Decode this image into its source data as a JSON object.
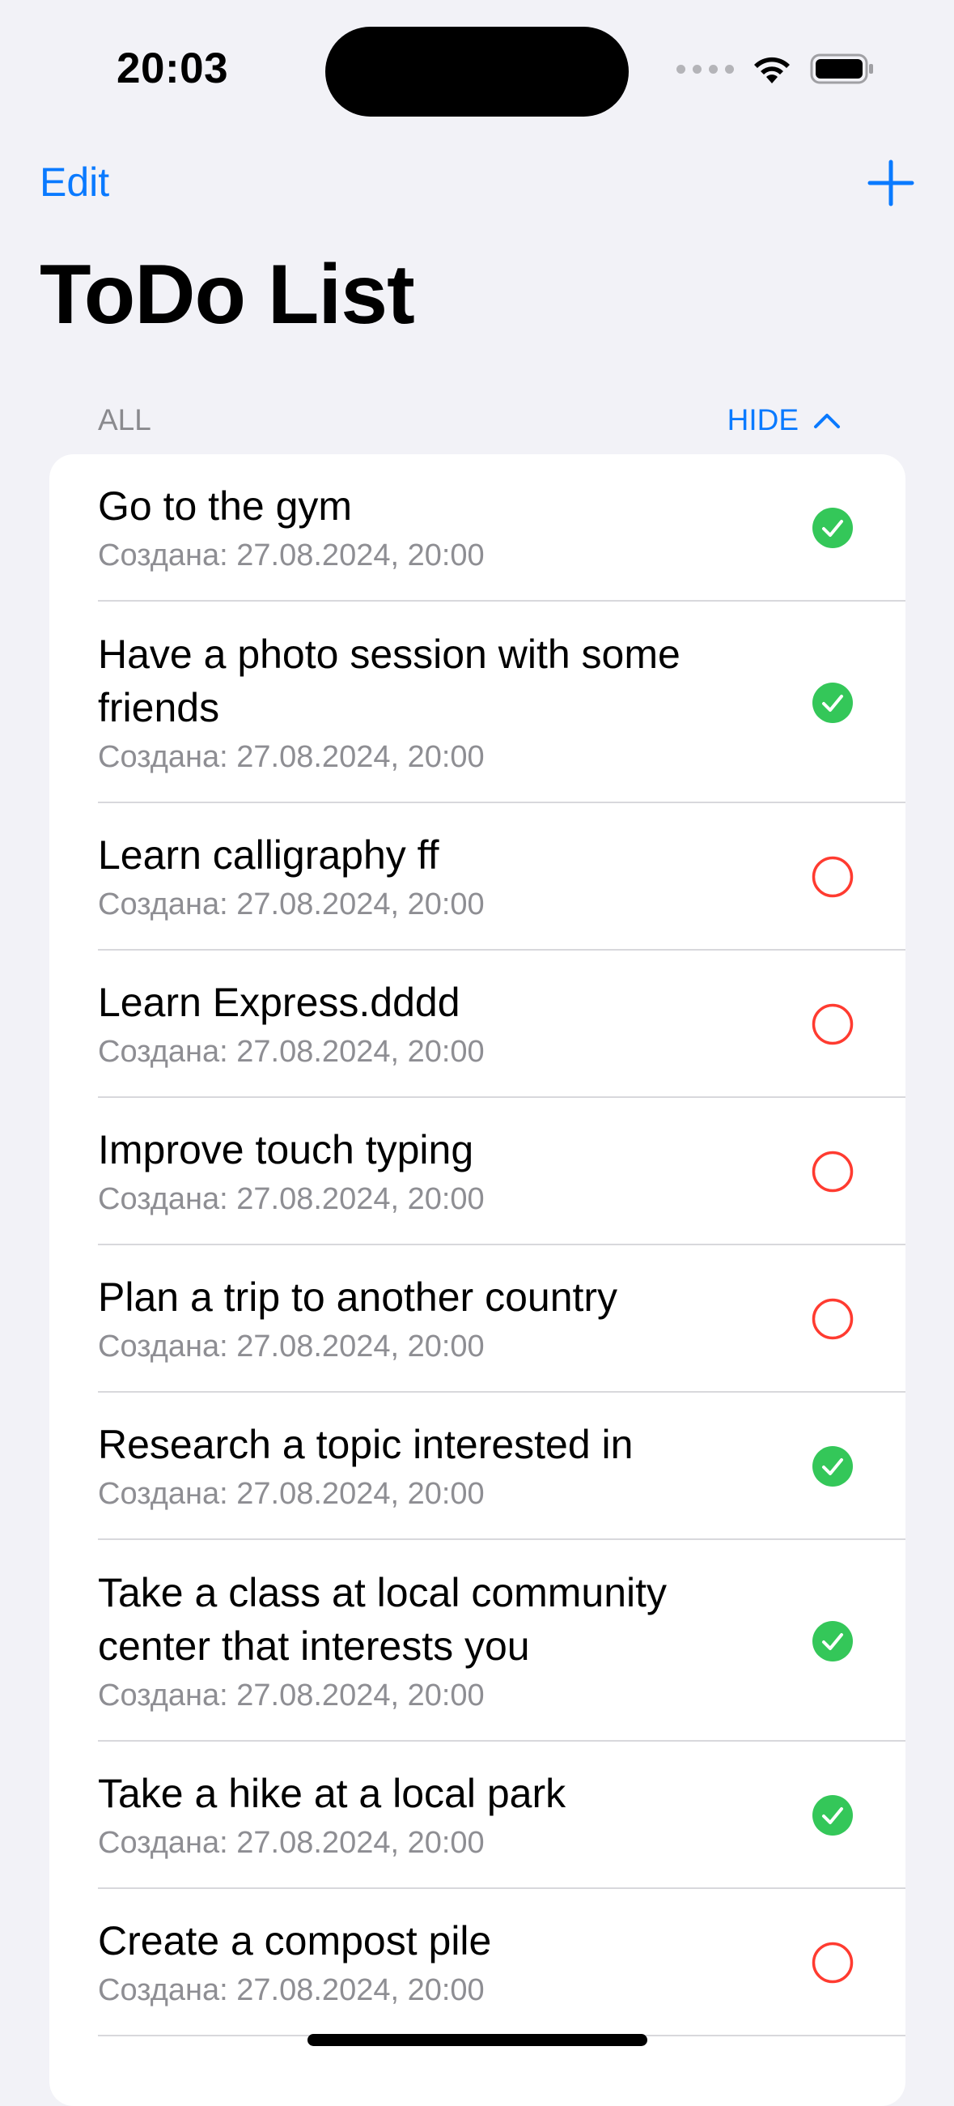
{
  "status_bar": {
    "time": "20:03"
  },
  "nav": {
    "edit_label": "Edit",
    "add_icon": "plus-icon"
  },
  "page_title": "ToDo List",
  "section": {
    "title": "ALL",
    "toggle_label": "HIDE",
    "toggle_icon": "chevron-up-icon"
  },
  "colors": {
    "accent": "#0a7aff",
    "done": "#34c759",
    "undone": "#ff3b30",
    "subtitle": "#8e8e93"
  },
  "tasks": [
    {
      "title": "Go to the gym",
      "created": "Создана: 27.08.2024, 20:00",
      "done": true
    },
    {
      "title": "Have a photo session with some friends",
      "created": "Создана: 27.08.2024, 20:00",
      "done": true
    },
    {
      "title": "Learn calligraphy ff",
      "created": "Создана: 27.08.2024, 20:00",
      "done": false
    },
    {
      "title": "Learn Express.dddd",
      "created": "Создана: 27.08.2024, 20:00",
      "done": false
    },
    {
      "title": "Improve touch typing",
      "created": "Создана: 27.08.2024, 20:00",
      "done": false
    },
    {
      "title": "Plan a trip to another country",
      "created": "Создана: 27.08.2024, 20:00",
      "done": false
    },
    {
      "title": "Research a topic interested in",
      "created": "Создана: 27.08.2024, 20:00",
      "done": true
    },
    {
      "title": "Take a class at local community center that interests you",
      "created": "Создана: 27.08.2024, 20:00",
      "done": true
    },
    {
      "title": "Take a hike at a local park",
      "created": "Создана: 27.08.2024, 20:00",
      "done": true
    },
    {
      "title": "Create a compost pile",
      "created": "Создана: 27.08.2024, 20:00",
      "done": false
    }
  ]
}
